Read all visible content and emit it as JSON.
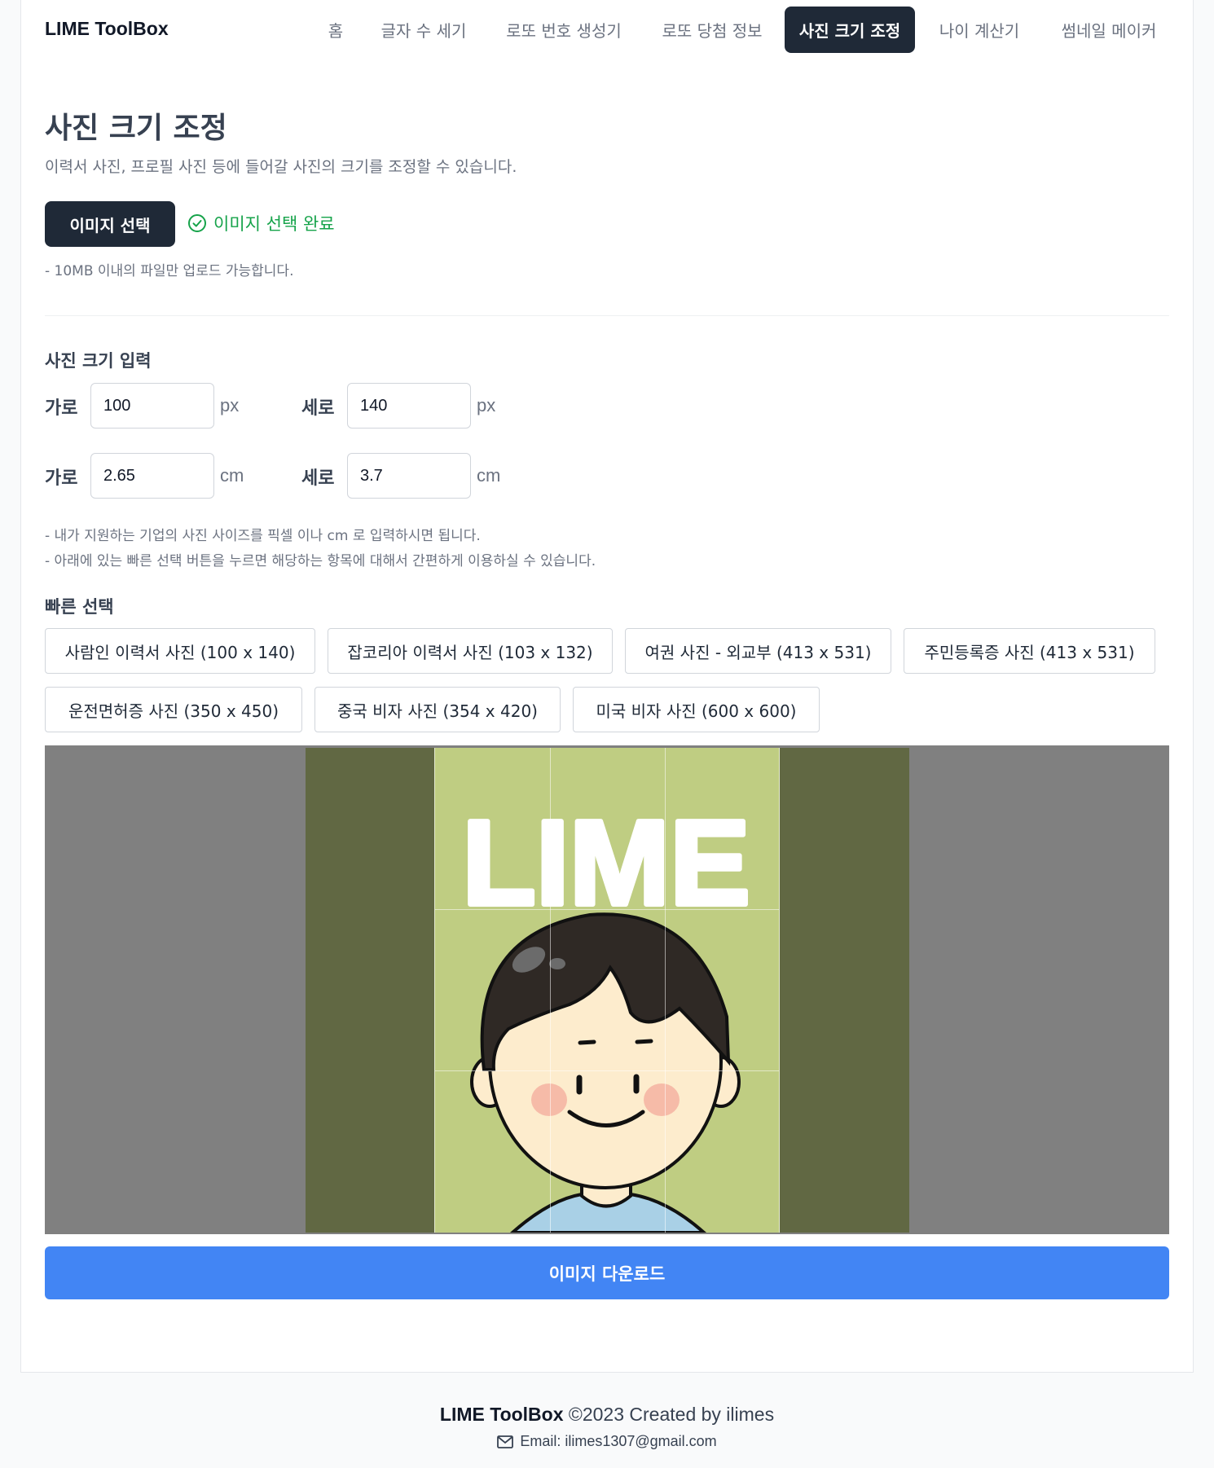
{
  "header": {
    "brand": "LIME ToolBox",
    "nav": [
      {
        "label": "홈",
        "active": false
      },
      {
        "label": "글자 수 세기",
        "active": false
      },
      {
        "label": "로또 번호 생성기",
        "active": false
      },
      {
        "label": "로또 당첨 정보",
        "active": false
      },
      {
        "label": "사진 크기 조정",
        "active": true
      },
      {
        "label": "나이 계산기",
        "active": false
      },
      {
        "label": "썸네일 메이커",
        "active": false
      }
    ]
  },
  "main": {
    "title": "사진 크기 조정",
    "description": "이력서 사진, 프로필 사진 등에 들어갈 사진의 크기를 조정할 수 있습니다.",
    "select_button": "이미지 선택",
    "select_status": "이미지 선택 완료",
    "upload_note": "- 10MB 이내의 파일만 업로드 가능합니다.",
    "size_section_title": "사진 크기 입력",
    "px_row": {
      "width_label": "가로",
      "width_value": "100",
      "width_unit": "px",
      "height_label": "세로",
      "height_value": "140",
      "height_unit": "px"
    },
    "cm_row": {
      "width_label": "가로",
      "width_value": "2.65",
      "width_unit": "cm",
      "height_label": "세로",
      "height_value": "3.7",
      "height_unit": "cm"
    },
    "notes": [
      "- 내가 지원하는 기업의 사진 사이즈를 픽셀 이나 cm 로 입력하시면 됩니다.",
      "- 아래에 있는 빠른 선택 버튼을 누르면 해당하는 항목에 대해서 간편하게 이용하실 수 있습니다."
    ],
    "quick_title": "빠른 선택",
    "quick_buttons": [
      "사람인 이력서 사진 (100 x 140)",
      "잡코리아 이력서 사진 (103 x 132)",
      "여권 사진 - 외교부 (413 x 531)",
      "주민등록증 사진 (413 x 531)",
      "운전면허증 사진 (350 x 450)",
      "중국 비자 사진 (354 x 420)",
      "미국 비자 사진 (600 x 600)"
    ],
    "preview_image_text": "LIME",
    "download_button": "이미지 다운로드"
  },
  "footer": {
    "brand": "LIME ToolBox",
    "copyright": " ©2023 Created by ilimes",
    "email": "Email: ilimes1307@gmail.com"
  },
  "colors": {
    "primary_dark": "#1f2937",
    "success": "#16a34a",
    "download_blue": "#4285f4",
    "preview_gray": "#808080",
    "photo_bg_dark": "#616843",
    "photo_bg_light": "#bfcd82"
  }
}
